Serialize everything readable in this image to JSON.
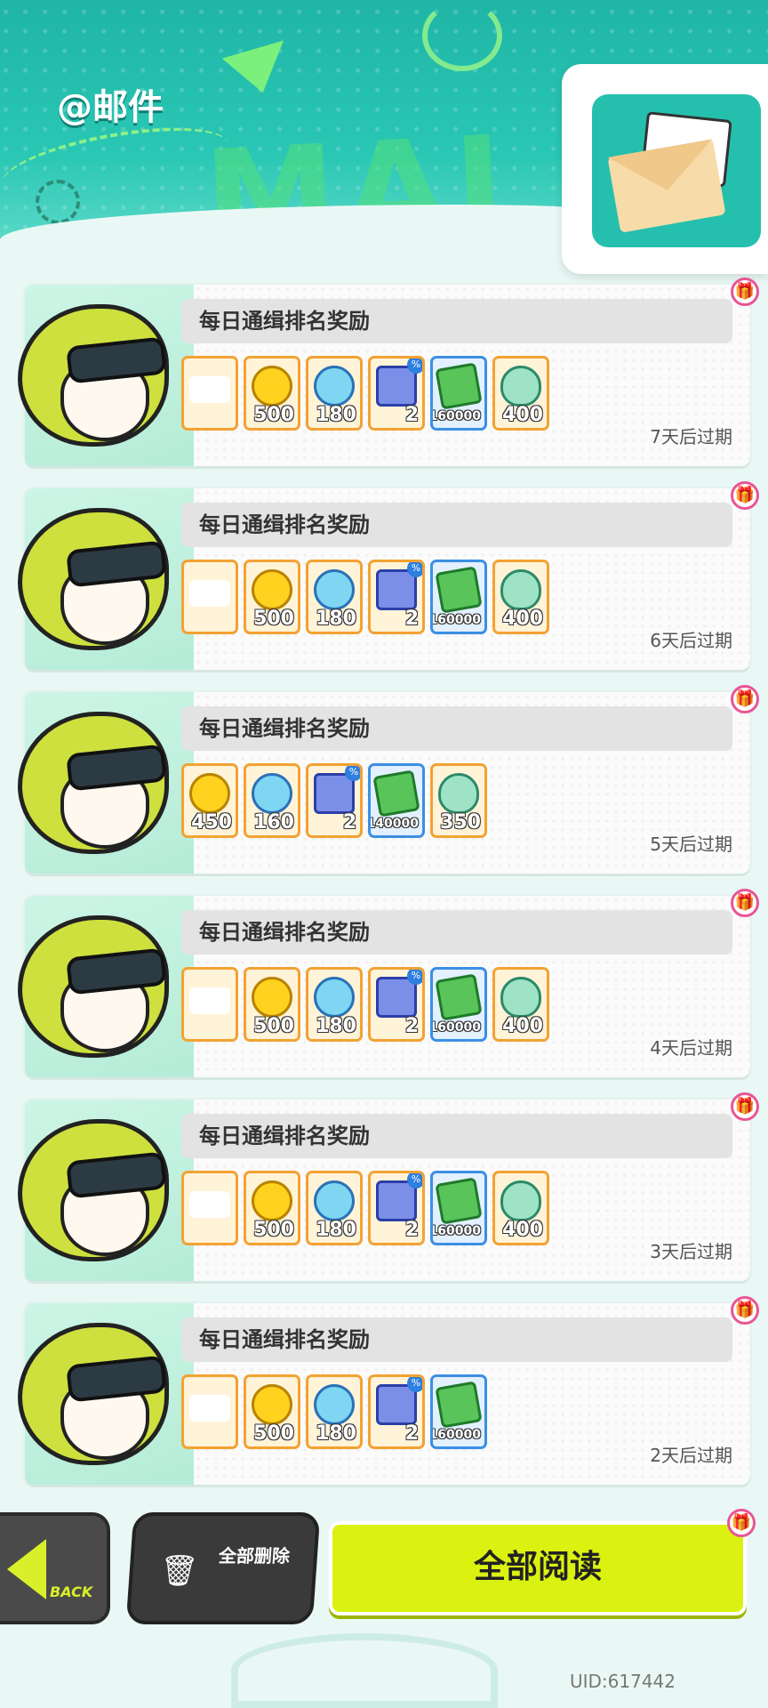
{
  "header": {
    "title": "@邮件"
  },
  "mails": [
    {
      "title": "每日通缉排名奖励",
      "expiry": "7天后过期",
      "items": [
        {
          "icon": "ticket-icon",
          "qty": "",
          "frame": "orange"
        },
        {
          "icon": "coin-icon",
          "qty": "500",
          "frame": "orange"
        },
        {
          "icon": "ball-icon",
          "qty": "180",
          "frame": "orange"
        },
        {
          "icon": "box-icon",
          "qty": "2",
          "frame": "orange",
          "tag": "%"
        },
        {
          "icon": "cash-icon",
          "qty": "160000",
          "frame": "blue"
        },
        {
          "icon": "egg-icon",
          "qty": "400",
          "frame": "orange"
        }
      ]
    },
    {
      "title": "每日通缉排名奖励",
      "expiry": "6天后过期",
      "items": [
        {
          "icon": "ticket-icon",
          "qty": "",
          "frame": "orange"
        },
        {
          "icon": "coin-icon",
          "qty": "500",
          "frame": "orange"
        },
        {
          "icon": "ball-icon",
          "qty": "180",
          "frame": "orange"
        },
        {
          "icon": "box-icon",
          "qty": "2",
          "frame": "orange",
          "tag": "%"
        },
        {
          "icon": "cash-icon",
          "qty": "160000",
          "frame": "blue"
        },
        {
          "icon": "egg-icon",
          "qty": "400",
          "frame": "orange"
        }
      ]
    },
    {
      "title": "每日通缉排名奖励",
      "expiry": "5天后过期",
      "items": [
        {
          "icon": "coin-icon",
          "qty": "450",
          "frame": "orange"
        },
        {
          "icon": "ball-icon",
          "qty": "160",
          "frame": "orange"
        },
        {
          "icon": "box-icon",
          "qty": "2",
          "frame": "orange",
          "tag": "%"
        },
        {
          "icon": "cash-icon",
          "qty": "140000",
          "frame": "blue"
        },
        {
          "icon": "egg-icon",
          "qty": "350",
          "frame": "orange"
        }
      ]
    },
    {
      "title": "每日通缉排名奖励",
      "expiry": "4天后过期",
      "items": [
        {
          "icon": "ticket-icon",
          "qty": "",
          "frame": "orange"
        },
        {
          "icon": "coin-icon",
          "qty": "500",
          "frame": "orange"
        },
        {
          "icon": "ball-icon",
          "qty": "180",
          "frame": "orange"
        },
        {
          "icon": "box-icon",
          "qty": "2",
          "frame": "orange",
          "tag": "%"
        },
        {
          "icon": "cash-icon",
          "qty": "160000",
          "frame": "blue"
        },
        {
          "icon": "egg-icon",
          "qty": "400",
          "frame": "orange"
        }
      ]
    },
    {
      "title": "每日通缉排名奖励",
      "expiry": "3天后过期",
      "items": [
        {
          "icon": "ticket-icon",
          "qty": "",
          "frame": "orange"
        },
        {
          "icon": "coin-icon",
          "qty": "500",
          "frame": "orange"
        },
        {
          "icon": "ball-icon",
          "qty": "180",
          "frame": "orange"
        },
        {
          "icon": "box-icon",
          "qty": "2",
          "frame": "orange",
          "tag": "%"
        },
        {
          "icon": "cash-icon",
          "qty": "160000",
          "frame": "blue"
        },
        {
          "icon": "egg-icon",
          "qty": "400",
          "frame": "orange"
        }
      ]
    },
    {
      "title": "每日通缉排名奖励",
      "expiry": "2天后过期",
      "items": [
        {
          "icon": "ticket-icon",
          "qty": "",
          "frame": "orange"
        },
        {
          "icon": "coin-icon",
          "qty": "500",
          "frame": "orange"
        },
        {
          "icon": "ball-icon",
          "qty": "180",
          "frame": "orange"
        },
        {
          "icon": "box-icon",
          "qty": "2",
          "frame": "orange",
          "tag": "%"
        },
        {
          "icon": "cash-icon",
          "qty": "160000",
          "frame": "blue"
        }
      ]
    }
  ],
  "footer": {
    "back_label": "BACK",
    "delete_label": "全部删除",
    "read_all_label": "全部阅读",
    "uid": "UID:617442"
  },
  "colors": {
    "header_teal": "#2ac7b4",
    "accent_lime": "#dbf211",
    "item_orange": "#f3a233",
    "item_blue": "#3b8fe3",
    "gift_pink": "#e85595"
  }
}
